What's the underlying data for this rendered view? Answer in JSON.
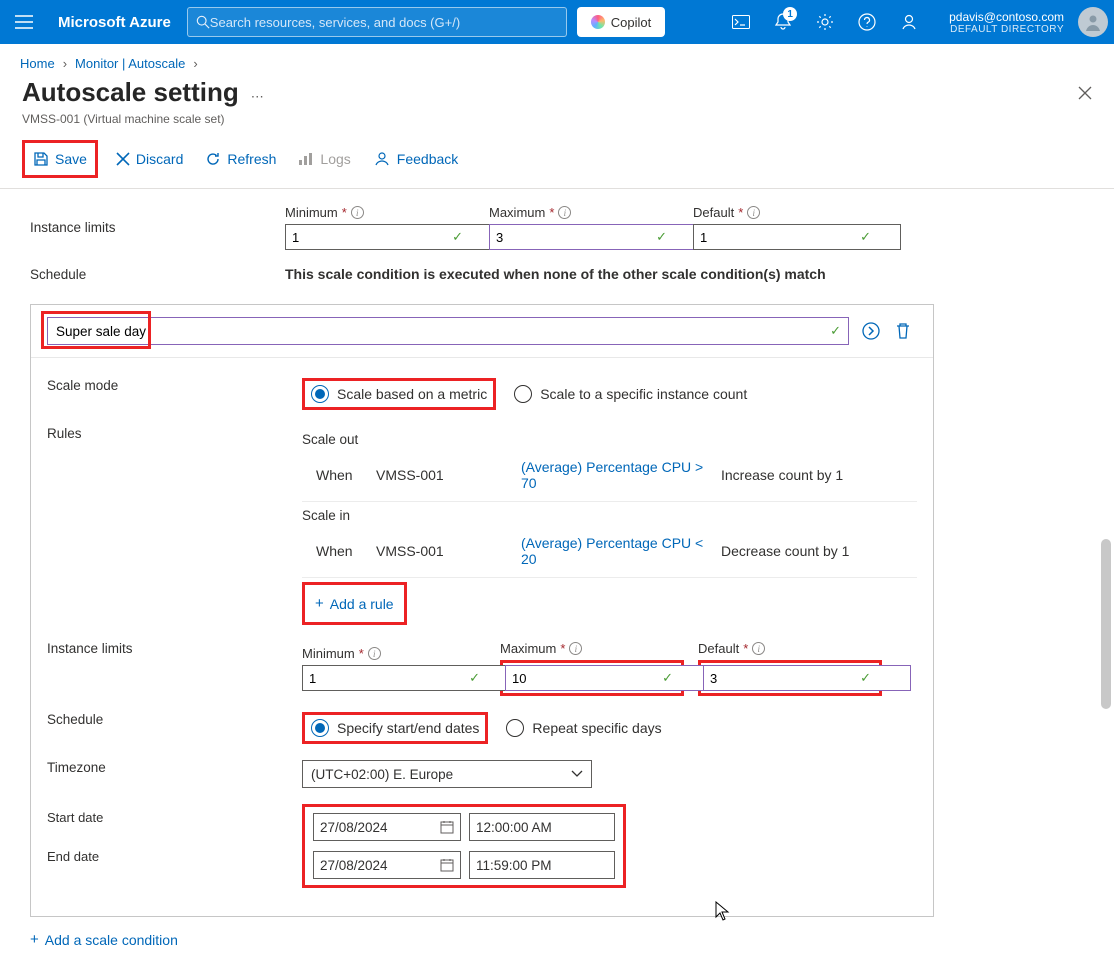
{
  "header": {
    "brand": "Microsoft Azure",
    "search_placeholder": "Search resources, services, and docs (G+/)",
    "copilot": "Copilot",
    "notification_count": "1",
    "user_email": "pdavis@contoso.com",
    "user_dir": "DEFAULT DIRECTORY"
  },
  "breadcrumb": {
    "home": "Home",
    "monitor": "Monitor | Autoscale"
  },
  "page": {
    "title": "Autoscale setting",
    "subtitle": "VMSS-001 (Virtual machine scale set)"
  },
  "toolbar": {
    "save": "Save",
    "discard": "Discard",
    "refresh": "Refresh",
    "logs": "Logs",
    "feedback": "Feedback"
  },
  "labels": {
    "instance_limits": "Instance limits",
    "schedule": "Schedule",
    "scale_mode": "Scale mode",
    "rules": "Rules",
    "timezone": "Timezone",
    "start_date": "Start date",
    "end_date": "End date",
    "minimum": "Minimum",
    "maximum": "Maximum",
    "default": "Default"
  },
  "top_condition": {
    "min": "1",
    "max": "3",
    "def": "1",
    "schedule_msg": "This scale condition is executed when none of the other scale condition(s) match"
  },
  "condition": {
    "name": "Super sale day",
    "scale_mode": {
      "metric": "Scale based on a metric",
      "count": "Scale to a specific instance count"
    },
    "rules": {
      "scale_out_title": "Scale out",
      "scale_in_title": "Scale in",
      "when": "When",
      "resource": "VMSS-001",
      "out_cond": "(Average) Percentage CPU > 70",
      "out_action": "Increase count by 1",
      "in_cond": "(Average) Percentage CPU < 20",
      "in_action": "Decrease count by 1",
      "add_rule": "Add a rule"
    },
    "limits": {
      "min": "1",
      "max": "10",
      "def": "3"
    },
    "schedule": {
      "specify": "Specify start/end dates",
      "repeat": "Repeat specific days"
    },
    "timezone": "(UTC+02:00) E. Europe",
    "start_date": "27/08/2024",
    "start_time": "12:00:00 AM",
    "end_date": "27/08/2024",
    "end_time": "11:59:00 PM"
  },
  "footer": {
    "add_condition": "Add a scale condition"
  }
}
